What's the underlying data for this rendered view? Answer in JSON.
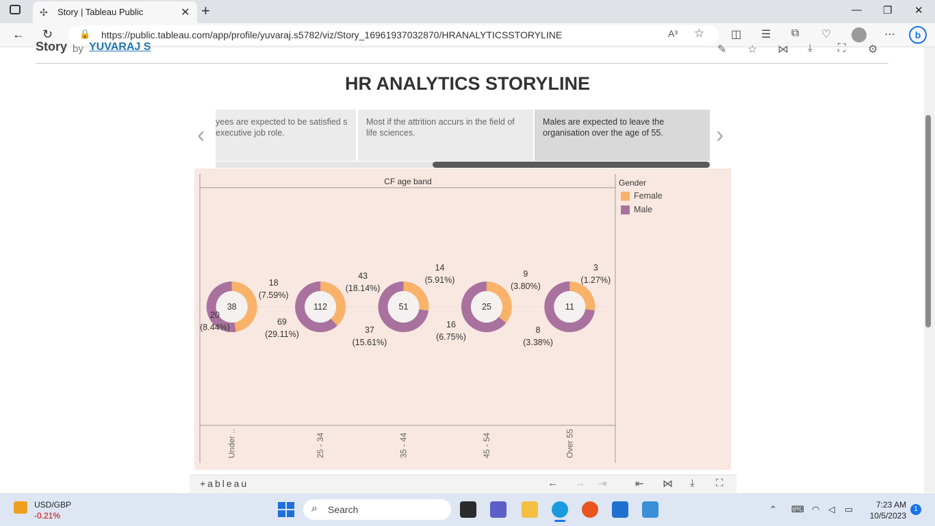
{
  "browser": {
    "tab_title": "Story | Tableau Public",
    "url": "https://public.tableau.com/app/profile/yuvaraj.s5782/viz/Story_16961937032870/HRANALYTICSSTORYLINE",
    "read_aloud": "A³"
  },
  "page": {
    "story_label": "Story",
    "by_label": "by",
    "author": "YUVARAJ S",
    "heading": "HR ANALYTICS STORYLINE"
  },
  "story_points": [
    "yees are expected to be satisfied s executive job role.",
    "Most if the attrition accurs in the field of life sciences.",
    "Males are expected  to leave the organisation over the age of 55."
  ],
  "chart_data": {
    "type": "pie",
    "subtype": "donut",
    "header": "CF age band",
    "legend_title": "Gender",
    "legend_position": "right",
    "series_colors": {
      "Female": "#f8b26a",
      "Male": "#a9729e"
    },
    "categories": [
      "Under ..",
      "25 - 34",
      "35 - 44",
      "45 - 54",
      "Over 55"
    ],
    "totals": [
      38,
      112,
      51,
      25,
      11
    ],
    "series": [
      {
        "name": "Female",
        "values": [
          18,
          43,
          14,
          9,
          3
        ],
        "labels": [
          "(7.59%)",
          "(18.14%)",
          "(5.91%)",
          "(3.80%)",
          "(1.27%)"
        ]
      },
      {
        "name": "Male",
        "values": [
          20,
          69,
          37,
          16,
          8
        ],
        "labels": [
          "(8.44%)",
          "(29.11%)",
          "(15.61%)",
          "(6.75%)",
          "(3.38%)"
        ]
      }
    ]
  },
  "legend": {
    "title": "Gender",
    "items": [
      {
        "label": "Female",
        "color": "#f8b26a"
      },
      {
        "label": "Male",
        "color": "#a9729e"
      }
    ]
  },
  "tableau_toolbar": {
    "logo": "+ableau"
  },
  "taskbar": {
    "currency": "USD/GBP",
    "change": "-0.21%",
    "search_placeholder": "Search",
    "time": "7:23 AM",
    "date": "10/5/2023",
    "notifications": "1"
  }
}
